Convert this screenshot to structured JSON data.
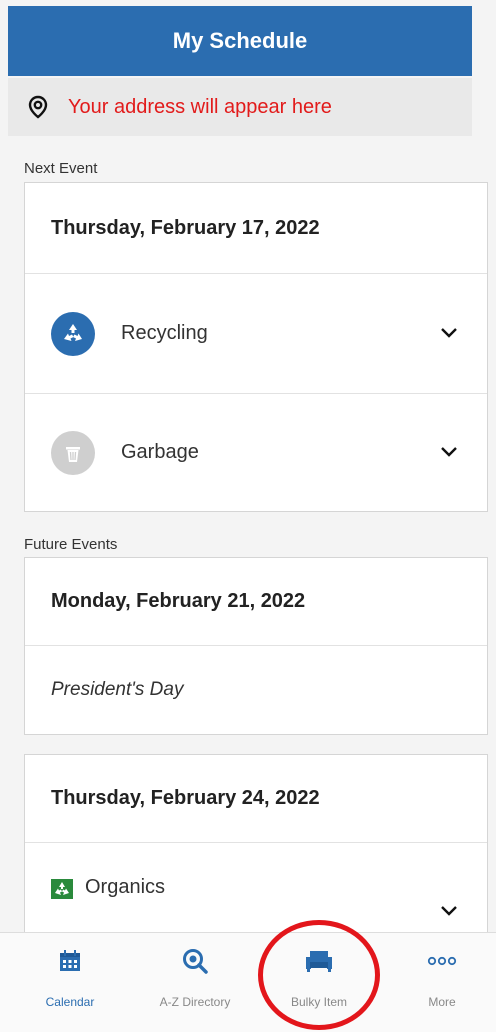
{
  "header": {
    "title": "My Schedule"
  },
  "address": {
    "text": "Your address will appear here"
  },
  "next_event": {
    "label": "Next Event",
    "date": "Thursday, February 17, 2022",
    "items": [
      {
        "label": "Recycling",
        "icon": "recycling-icon",
        "color": "#2b6db0"
      },
      {
        "label": "Garbage",
        "icon": "garbage-icon",
        "color": "#cfcfcf"
      }
    ]
  },
  "future_events": {
    "label": "Future Events",
    "events": [
      {
        "date": "Monday, February 21, 2022",
        "note": "President's Day"
      },
      {
        "date": "Thursday, February 24, 2022",
        "items": [
          {
            "label": "Organics",
            "icon": "organics-icon",
            "color": "#2a8a3c"
          }
        ]
      }
    ]
  },
  "tabbar": {
    "tabs": [
      {
        "label": "Calendar",
        "icon": "calendar-icon",
        "active": true
      },
      {
        "label": "A-Z Directory",
        "icon": "search-icon"
      },
      {
        "label": "Bulky Item",
        "icon": "armchair-icon"
      },
      {
        "label": "More",
        "icon": "more-dots-icon"
      }
    ]
  },
  "colors": {
    "brand": "#2b6db0",
    "address_text": "#e21b1b",
    "highlight": "#e3161b"
  }
}
